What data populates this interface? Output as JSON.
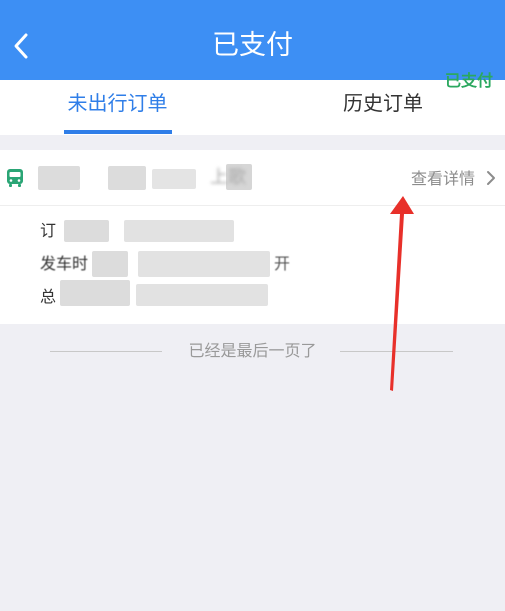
{
  "header": {
    "title": "已支付",
    "back_icon": "chevron-left-icon"
  },
  "tabs": [
    {
      "label": "未出行订单",
      "active": true
    },
    {
      "label": "历史订单",
      "active": false
    }
  ],
  "order": {
    "route_visible_fragment": "上歌",
    "details_label": "查看详情",
    "status": "已支付",
    "rows": [
      {
        "label_visible": "订"
      },
      {
        "label_visible": "发车时",
        "value_tail": "开"
      },
      {
        "label_visible": "总"
      }
    ]
  },
  "footer": {
    "end_text": "已经是最后一页了"
  },
  "colors": {
    "header_bg": "#3d8ff4",
    "tab_active": "#2f7ee8",
    "status_green": "#2ba85f",
    "bus_icon": "#2aa575",
    "annotation_arrow": "#e8302a"
  }
}
